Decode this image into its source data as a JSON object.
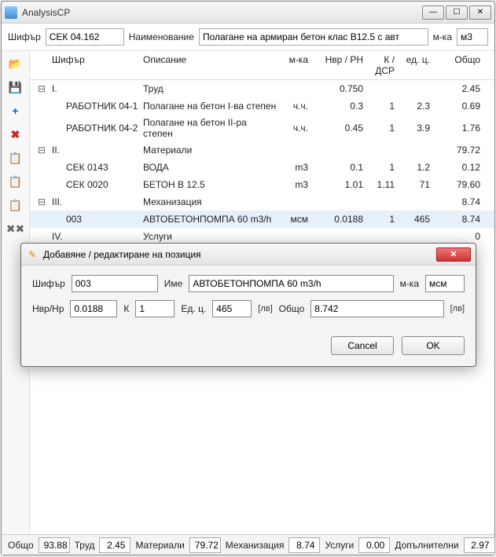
{
  "window": {
    "title": "AnalysisCP"
  },
  "topform": {
    "code_label": "Шифър",
    "code_value": "СЕК 04.162",
    "name_label": "Наименование",
    "name_value": "Полагане на армиран бетон клас В12.5 с авт",
    "unit_label": "м-ка",
    "unit_value": "м3"
  },
  "grid": {
    "headers": {
      "code": "Шифър",
      "desc": "Описание",
      "unit": "м-ка",
      "nvr": "Нвр / РН",
      "k": "К / ДСР",
      "edc": "ед. ц.",
      "total": "Общо"
    },
    "rows": [
      {
        "exp": "⊟",
        "code": "I.",
        "desc": "Труд",
        "unit": "",
        "nvr": "0.750",
        "k": "",
        "edc": "",
        "total": "2.45",
        "ind": false
      },
      {
        "exp": "",
        "code": "РАБОТНИК 04-1",
        "desc": "Полагане на бетон I-ва степен",
        "unit": "ч.ч.",
        "nvr": "0.3",
        "k": "1",
        "edc": "2.3",
        "total": "0.69",
        "ind": true
      },
      {
        "exp": "",
        "code": "РАБОТНИК 04-2",
        "desc": "Полагане на бетон II-ра степен",
        "unit": "ч.ч.",
        "nvr": "0.45",
        "k": "1",
        "edc": "3.9",
        "total": "1.76",
        "ind": true
      },
      {
        "exp": "⊟",
        "code": "II.",
        "desc": "Материали",
        "unit": "",
        "nvr": "",
        "k": "",
        "edc": "",
        "total": "79.72",
        "ind": false
      },
      {
        "exp": "",
        "code": "СЕК 0143",
        "desc": "ВОДА",
        "unit": "m3",
        "nvr": "0.1",
        "k": "1",
        "edc": "1.2",
        "total": "0.12",
        "ind": true
      },
      {
        "exp": "",
        "code": "СЕК 0020",
        "desc": "БЕТОН В 12.5",
        "unit": "m3",
        "nvr": "1.01",
        "k": "1.11",
        "edc": "71",
        "total": "79.60",
        "ind": true
      },
      {
        "exp": "⊟",
        "code": "III.",
        "desc": "Механизация",
        "unit": "",
        "nvr": "",
        "k": "",
        "edc": "",
        "total": "8.74",
        "ind": false
      },
      {
        "exp": "",
        "code": "003",
        "desc": "АВТОБЕТОНПОМПА 60 m3/h",
        "unit": "мсм",
        "nvr": "0.0188",
        "k": "1",
        "edc": "465",
        "total": "8.74",
        "ind": true,
        "sel": true
      },
      {
        "exp": "",
        "code": "IV.",
        "desc": "Услуги",
        "unit": "",
        "nvr": "",
        "k": "",
        "edc": "",
        "total": "0",
        "ind": false
      }
    ]
  },
  "status": {
    "total_label": "Общо",
    "total_val": "93.88",
    "labour_label": "Труд",
    "labour_val": "2.45",
    "mat_label": "Материали",
    "mat_val": "79.72",
    "mech_label": "Механизация",
    "mech_val": "8.74",
    "serv_label": "Услуги",
    "serv_val": "0.00",
    "extra_label": "Допълнителни",
    "extra_val": "2.97"
  },
  "dialog": {
    "title": "Добавяне / редактиране на позиция",
    "code_label": "Шифър",
    "code_value": "003",
    "name_label": "Име",
    "name_value": "АВТОБЕТОНПОМПА 60 m3/h",
    "unit_label": "м-ка",
    "unit_value": "мсм",
    "nvr_label": "Нвр/Нр",
    "nvr_value": "0.0188",
    "k_label": "К",
    "k_value": "1",
    "edc_label": "Ед. ц.",
    "edc_value": "465",
    "cur1": "[лв]",
    "total_label": "Общо",
    "total_value": "8.742",
    "cur2": "[лв]",
    "cancel": "Cancel",
    "ok": "OK"
  }
}
